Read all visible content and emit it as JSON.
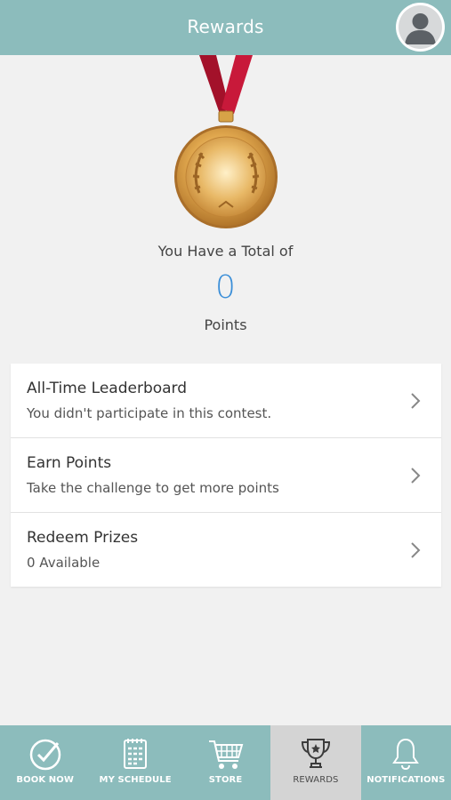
{
  "header": {
    "title": "Rewards"
  },
  "summary": {
    "total_label": "You Have a Total of",
    "points": "0",
    "points_label": "Points"
  },
  "menu": [
    {
      "title": "All-Time Leaderboard",
      "subtitle": "You didn't participate in this contest."
    },
    {
      "title": "Earn Points",
      "subtitle": "Take the challenge to get more points"
    },
    {
      "title": "Redeem Prizes",
      "subtitle": "0 Available"
    }
  ],
  "tabs": [
    {
      "label": "BOOK NOW",
      "icon": "check-circle-icon"
    },
    {
      "label": "MY SCHEDULE",
      "icon": "calendar-icon"
    },
    {
      "label": "STORE",
      "icon": "cart-icon"
    },
    {
      "label": "REWARDS",
      "icon": "trophy-icon",
      "active": true
    },
    {
      "label": "NOTIFICATIONS",
      "icon": "bell-icon"
    }
  ],
  "colors": {
    "header": "#8cbcbc",
    "accent": "#3a8ed8",
    "ribbon": "#c0172f",
    "medal": "#d9a441"
  }
}
